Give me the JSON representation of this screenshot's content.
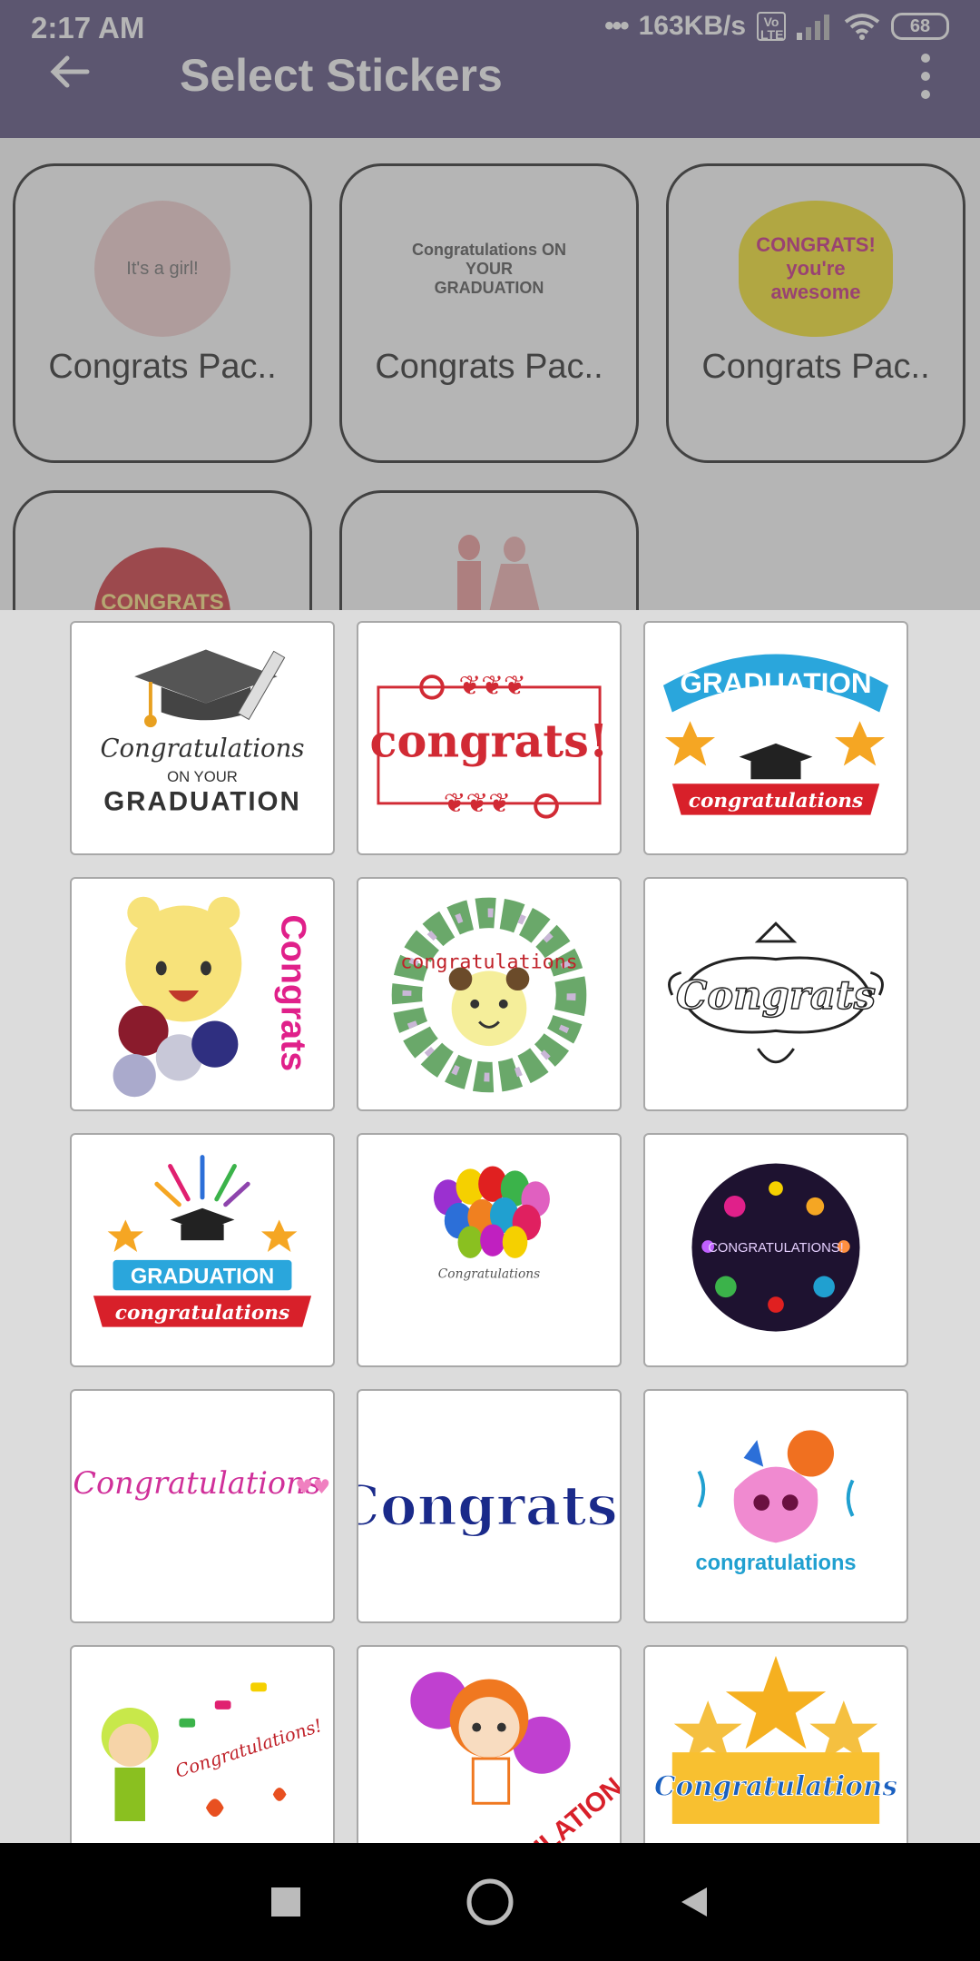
{
  "status_bar": {
    "time": "2:17 AM",
    "network_speed": "163KB/s",
    "volte": "Vo LTE",
    "battery": "68"
  },
  "toolbar": {
    "title": "Select Stickers",
    "back_icon": "arrow-left-icon",
    "menu_icon": "more-vert-icon"
  },
  "packs": [
    {
      "label": "Congrats Pac..",
      "thumb_text": "It's a girl!"
    },
    {
      "label": "Congrats Pac..",
      "thumb_text": "Congratulations ON YOUR GRADUATION"
    },
    {
      "label": "Congrats Pac..",
      "thumb_text": "CONGRATS! you're awesome"
    },
    {
      "label": "",
      "thumb_text": "CONGRATS YOU WIN"
    },
    {
      "label": "",
      "thumb_text": ""
    }
  ],
  "stickers": [
    {
      "lines": [
        "Congratulations",
        "ON YOUR",
        "GRADUATION"
      ]
    },
    {
      "lines": [
        "congrats!"
      ]
    },
    {
      "lines": [
        "GRADUATION",
        "congratulations"
      ]
    },
    {
      "lines": [
        "Congrats"
      ]
    },
    {
      "lines": [
        "congratulations"
      ]
    },
    {
      "lines": [
        "Congrats"
      ]
    },
    {
      "lines": [
        "GRADUATION",
        "congratulations"
      ]
    },
    {
      "lines": [
        "Congratulations"
      ]
    },
    {
      "lines": [
        "CONGRATULATIONS!"
      ]
    },
    {
      "lines": [
        "Congratulations"
      ]
    },
    {
      "lines": [
        "Congrats!"
      ]
    },
    {
      "lines": [
        "congratulations"
      ]
    },
    {
      "lines": [
        "Congratulations!"
      ]
    },
    {
      "lines": [
        "CONGRATULATION"
      ]
    },
    {
      "lines": [
        "Congratulations"
      ]
    }
  ],
  "navbar": {
    "recents_icon": "square-icon",
    "home_icon": "circle-icon",
    "back_icon": "triangle-back-icon"
  }
}
